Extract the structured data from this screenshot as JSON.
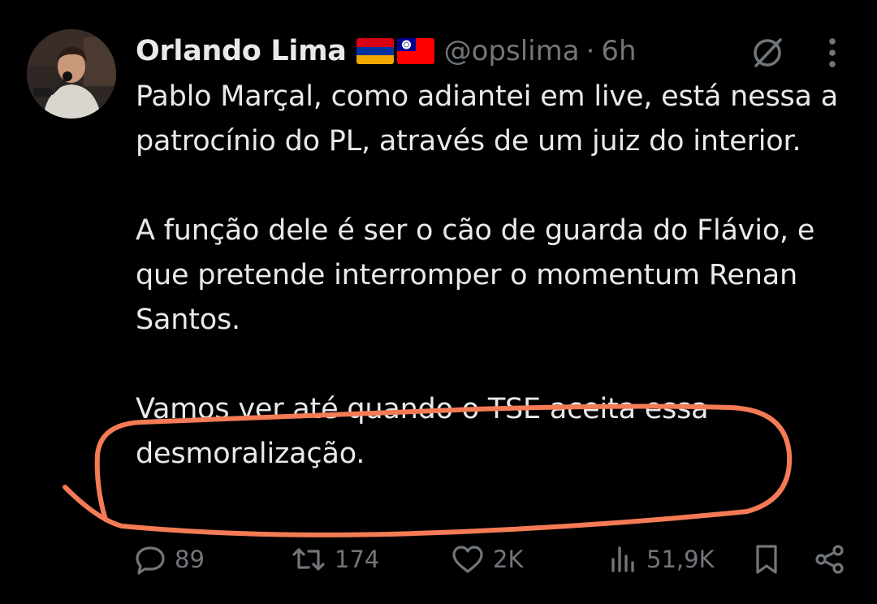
{
  "tweet": {
    "author": {
      "display_name": "Orlando Lima",
      "handle": "@opslima",
      "separator": "·",
      "time": "6h",
      "flags": [
        "armenia-flag",
        "taiwan-flag"
      ]
    },
    "paragraphs": [
      "Pablo Marçal, como adiantei em live, está nessa a patrocínio do PL, através de um juiz do interior.",
      "A função dele é ser o cão de guarda do Flávio, e que pretende interromper o momentum Renan Santos.",
      "Vamos ver até quando o TSE aceita essa desmoralização."
    ],
    "actions": {
      "replies": "89",
      "reposts": "174",
      "likes": "2K",
      "views": "51,9K"
    },
    "icons": {
      "grok": "grok-icon",
      "more": "more-vertical-icon",
      "reply": "reply-icon",
      "repost": "repost-icon",
      "like": "heart-icon",
      "views": "views-icon",
      "bookmark": "bookmark-icon",
      "share": "share-icon"
    }
  },
  "colors": {
    "background": "#000000",
    "text": "#e7e9ea",
    "muted": "#71767b",
    "annotation": "#f47b55"
  }
}
